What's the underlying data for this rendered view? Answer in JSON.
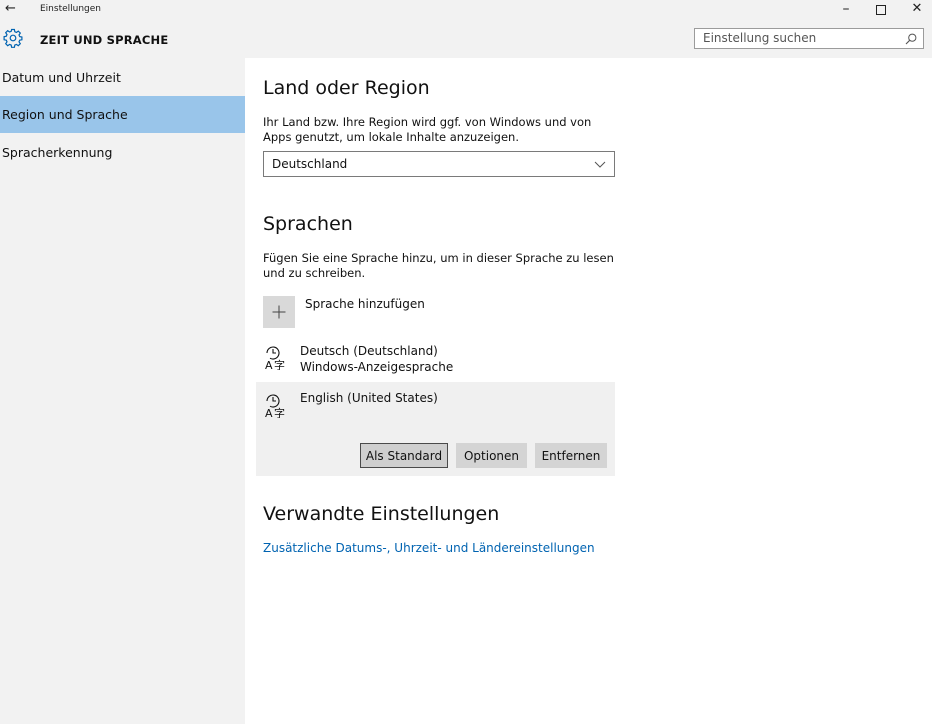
{
  "window": {
    "title": "Einstellungen",
    "back_glyph": "←",
    "minimize_glyph": "–",
    "close_glyph": "✕"
  },
  "header": {
    "title": "ZEIT UND SPRACHE",
    "icon": "gear-icon"
  },
  "search": {
    "placeholder": "Einstellung suchen",
    "value": ""
  },
  "sidebar": {
    "items": [
      {
        "label": "Datum und Uhrzeit",
        "active": false
      },
      {
        "label": "Region und Sprache",
        "active": true
      },
      {
        "label": "Spracherkennung",
        "active": false
      }
    ]
  },
  "region": {
    "title": "Land oder Region",
    "description": "Ihr Land bzw. Ihre Region wird ggf. von Windows und von Apps genutzt, um lokale Inhalte anzuzeigen.",
    "selected": "Deutschland"
  },
  "languages": {
    "title": "Sprachen",
    "description": "Fügen Sie eine Sprache hinzu, um in dieser Sprache zu lesen und zu schreiben.",
    "add_label": "Sprache hinzufügen",
    "items": [
      {
        "name": "Deutsch (Deutschland)",
        "subtitle": "Windows-Anzeigesprache"
      },
      {
        "name": "English (United States)",
        "subtitle": ""
      }
    ],
    "buttons": {
      "set_default": "Als Standard",
      "options": "Optionen",
      "remove": "Entfernen"
    }
  },
  "related": {
    "title": "Verwandte Einstellungen",
    "link": "Zusätzliche Datums-, Uhrzeit- und Ländereinstellungen"
  },
  "colors": {
    "accent": "#0063b1",
    "sidebar_active": "#99c5ea",
    "chrome_bg": "#f2f2f2"
  }
}
